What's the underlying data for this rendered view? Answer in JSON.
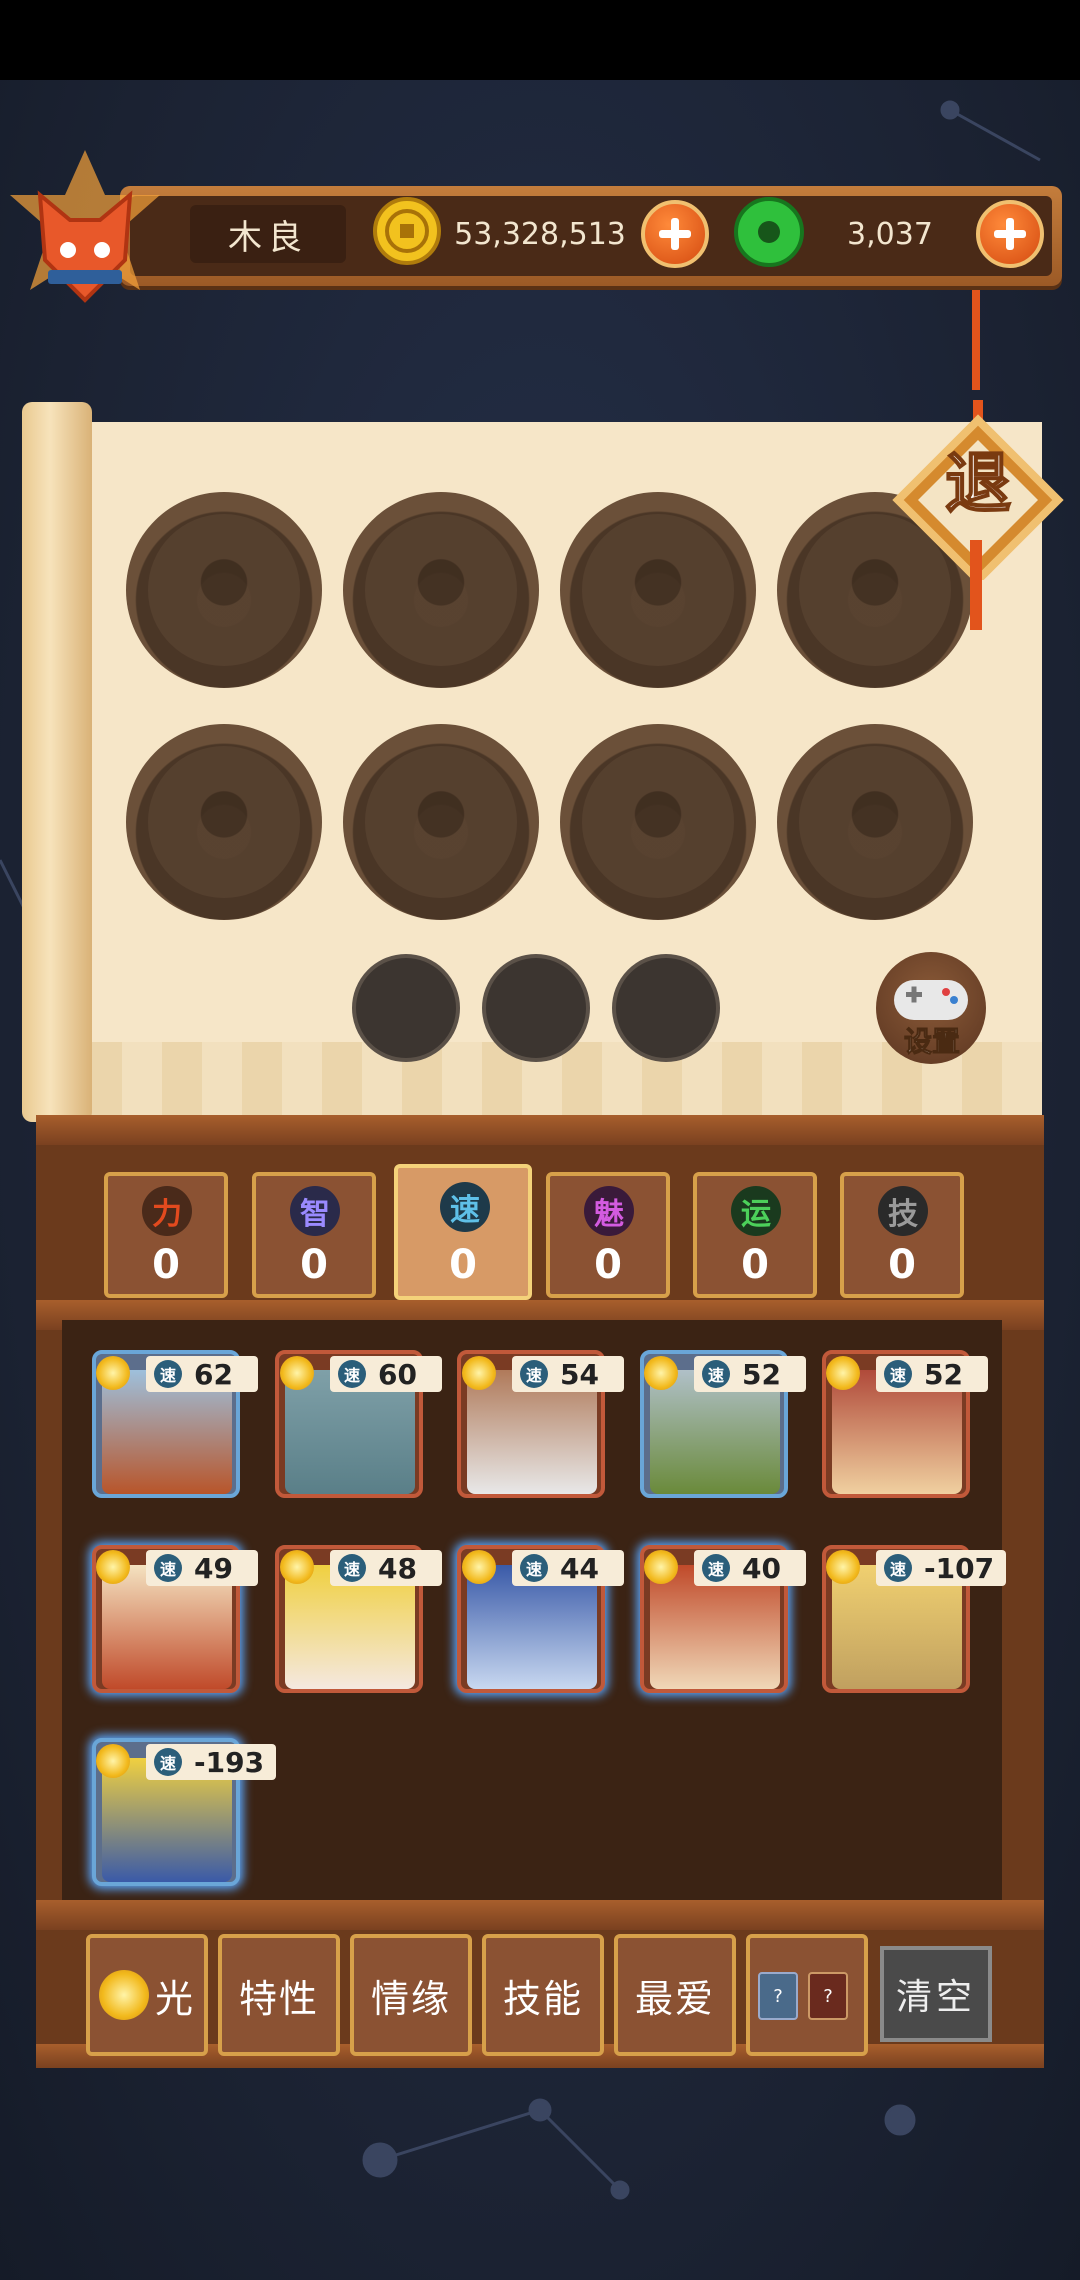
{
  "player": {
    "name": "木良"
  },
  "currency": {
    "coins": "53,328,513",
    "jade": "3,037"
  },
  "buttons": {
    "exit": "退",
    "settings": "设置",
    "clear": "清空"
  },
  "stats": [
    {
      "glyph": "力",
      "value": "0",
      "color": "#c0391b"
    },
    {
      "glyph": "智",
      "value": "0",
      "color": "#6a6ad0"
    },
    {
      "glyph": "速",
      "value": "0",
      "color": "#2a7aa6"
    },
    {
      "glyph": "魅",
      "value": "0",
      "color": "#b13fb8"
    },
    {
      "glyph": "运",
      "value": "0",
      "color": "#2e9a3c"
    },
    {
      "glyph": "技",
      "value": "0",
      "color": "#6a6a6a"
    }
  ],
  "selected_stat": "速",
  "speed_glyph": "速",
  "heroes": [
    {
      "speed": "62"
    },
    {
      "speed": "60"
    },
    {
      "speed": "54"
    },
    {
      "speed": "52"
    },
    {
      "speed": "52"
    },
    {
      "speed": "49"
    },
    {
      "speed": "48"
    },
    {
      "speed": "44"
    },
    {
      "speed": "40"
    },
    {
      "speed": "-107"
    },
    {
      "speed": "-193"
    }
  ],
  "filters": {
    "light": "光",
    "trait": "特性",
    "bond": "情缘",
    "skill": "技能",
    "favorite": "最爱",
    "unknown": "?"
  }
}
